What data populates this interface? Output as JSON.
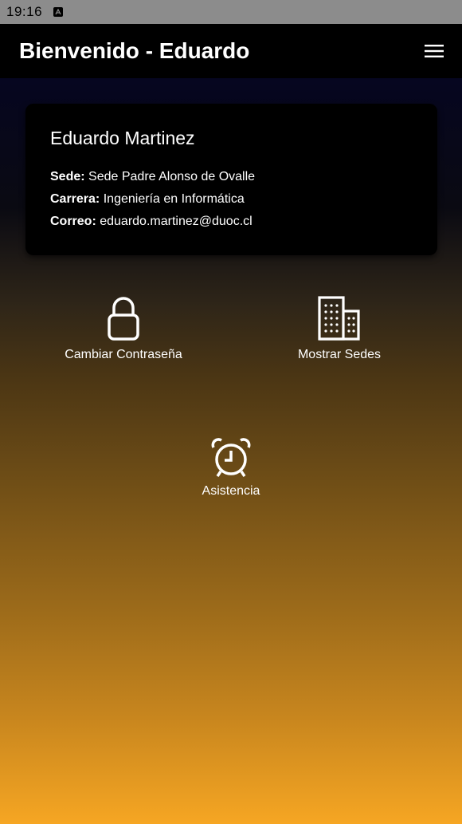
{
  "status_bar": {
    "time": "19:16",
    "app_icon": "a-icon"
  },
  "app_bar": {
    "title": "Bienvenido - Eduardo",
    "menu_icon": "hamburger-menu-icon"
  },
  "profile": {
    "name": "Eduardo Martinez",
    "fields": [
      {
        "label": "Sede:",
        "value": "Sede Padre Alonso de Ovalle"
      },
      {
        "label": "Carrera:",
        "value": "Ingeniería en Informática"
      },
      {
        "label": "Correo:",
        "value": "eduardo.martinez@duoc.cl"
      }
    ]
  },
  "actions": [
    {
      "label": "Cambiar Contraseña",
      "icon": "lock-icon"
    },
    {
      "label": "Mostrar Sedes",
      "icon": "building-icon"
    },
    {
      "label": "Asistencia",
      "icon": "alarm-clock-icon"
    }
  ],
  "colors": {
    "app_bar": "#000000",
    "gradient_top": "#05052a",
    "gradient_bottom": "#f6a623",
    "text": "#ffffff"
  }
}
